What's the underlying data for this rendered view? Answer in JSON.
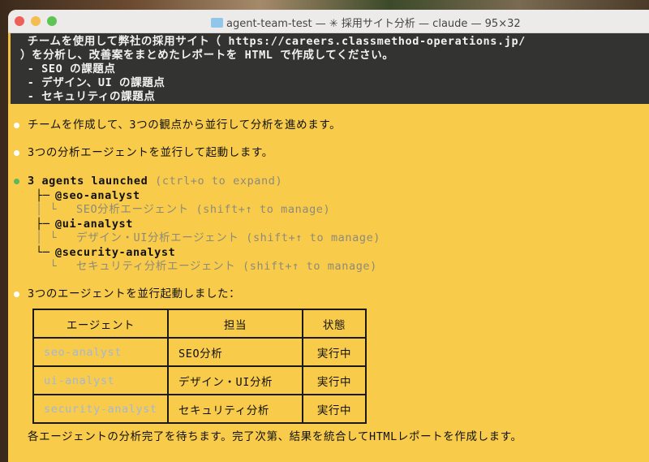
{
  "window": {
    "title": "agent-team-test — ✳ 採用サイト分析 — claude — 95×32"
  },
  "prompt": {
    "lines": [
      " チームを使用して弊社の採用サイト（ https://careers.classmethod-operations.jp/",
      "）を分析し、改善案をまとめたレポートを HTML で作成してください。",
      " - SEO の課題点",
      " - デザイン、UI の課題点",
      " - セキュリティの課題点"
    ]
  },
  "messages": {
    "m1": "チームを作成して、3つの観点から並行して分析を進めます。",
    "m2": "3つの分析エージェントを並行して起動します。",
    "launch": {
      "title": "3 agents launched",
      "hint": "(ctrl+o to expand)"
    },
    "agents": [
      {
        "name": "@seo-analyst",
        "desc": "SEO分析エージェント (shift+↑ to manage)"
      },
      {
        "name": "@ui-analyst",
        "desc": "デザイン・UI分析エージェント (shift+↑ to manage)"
      },
      {
        "name": "@security-analyst",
        "desc": "セキュリティ分析エージェント (shift+↑ to manage)"
      }
    ],
    "m3": "3つのエージェントを並行起動しました：",
    "m4": "各エージェントの分析完了を待ちます。完了次第、結果を統合してHTMLレポートを作成します。"
  },
  "table": {
    "headers": [
      "エージェント",
      "担当",
      "状態"
    ],
    "rows": [
      [
        "seo-analyst",
        "SEO分析",
        "実行中"
      ],
      [
        "ui-analyst",
        "デザイン・UI分析",
        "実行中"
      ],
      [
        "security-analyst",
        "セキュリティ分析",
        "実行中"
      ]
    ]
  },
  "colors": {
    "background": "#f8cb4a",
    "agent_name": "#a3b7d9",
    "status_dot_done": "#5cb85c",
    "bullet": "#ffffff"
  }
}
